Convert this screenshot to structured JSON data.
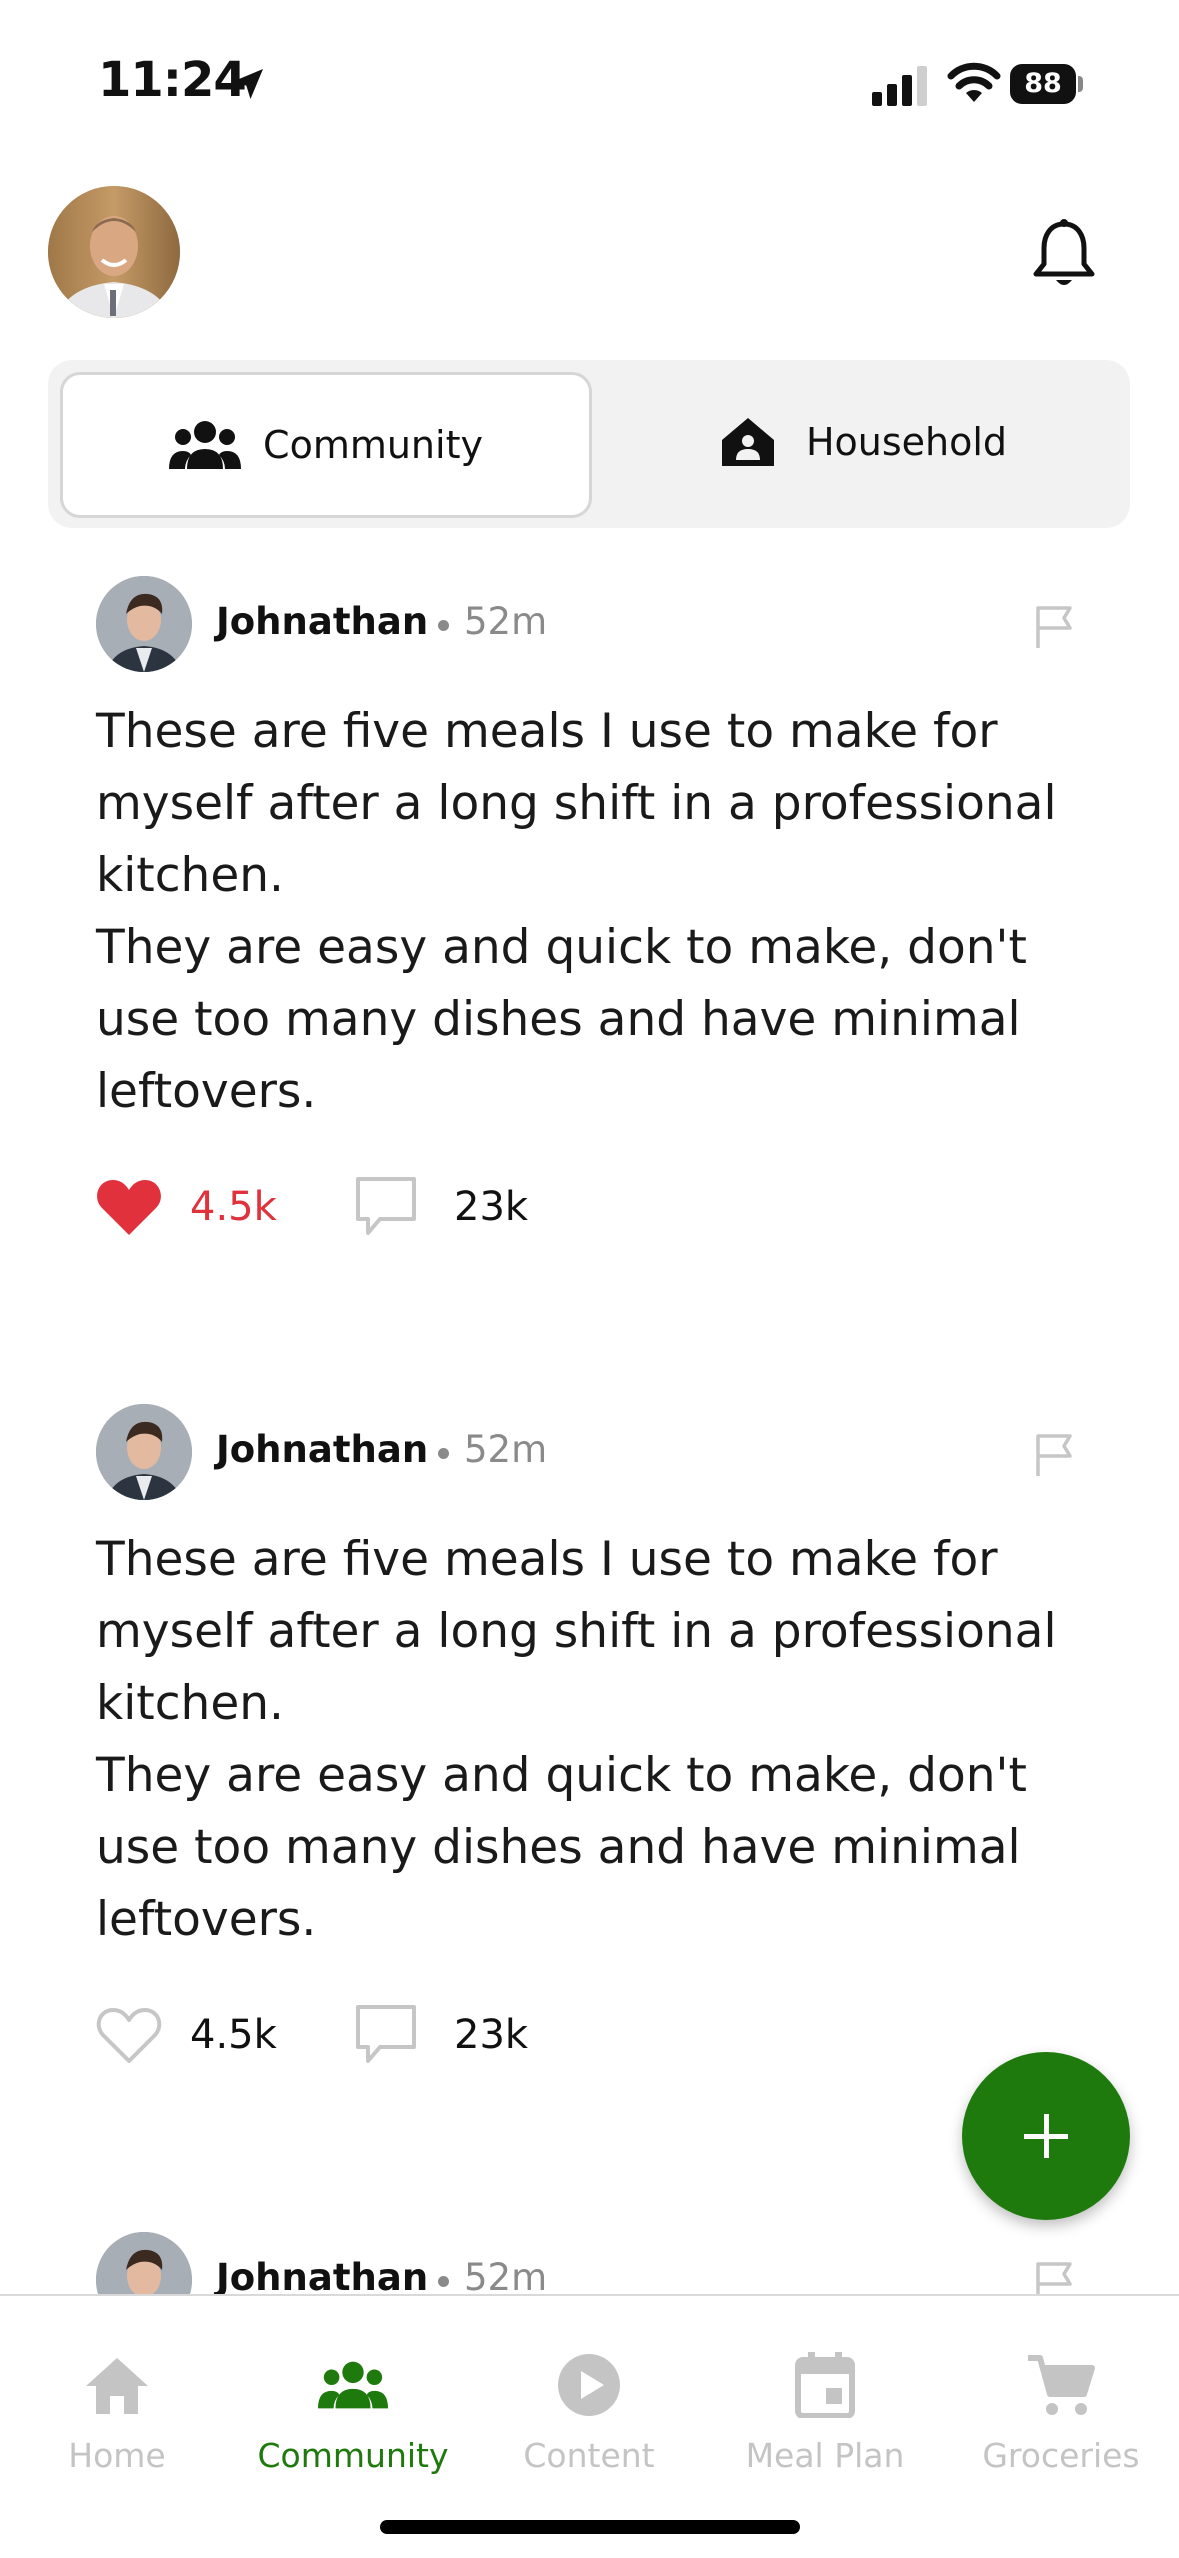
{
  "status_bar": {
    "time": "11:24",
    "battery": "88"
  },
  "header": {
    "avatar_icon": "user-avatar",
    "notification_icon": "bell-icon"
  },
  "segments": [
    {
      "label": "Community",
      "icon": "people-icon",
      "active": true
    },
    {
      "label": "Household",
      "icon": "home-icon",
      "active": false
    }
  ],
  "posts": [
    {
      "author": "Johnathan",
      "time": "52m",
      "text": "These are five meals I use to make for myself after a long shift in a professional kitchen.\nThey are easy and quick to make, don't use too many dishes and have minimal leftovers.",
      "likes": "4.5k",
      "comments": "23k",
      "liked": true
    },
    {
      "author": "Johnathan",
      "time": "52m",
      "text": "These are five meals I use to make for myself after a long shift in a professional kitchen.\nThey are easy and quick to make, don't use too many dishes and have minimal leftovers.",
      "likes": "4.5k",
      "comments": "23k",
      "liked": false
    },
    {
      "author": "Johnathan",
      "time": "52m"
    }
  ],
  "colors": {
    "accent": "#1f7a0e",
    "like": "#e0313d",
    "inactive": "#c4c4c4"
  },
  "bottom_nav": [
    {
      "label": "Home",
      "icon": "home-icon",
      "active": false
    },
    {
      "label": "Community",
      "icon": "people-icon",
      "active": true
    },
    {
      "label": "Content",
      "icon": "play-icon",
      "active": false
    },
    {
      "label": "Meal Plan",
      "icon": "calendar-icon",
      "active": false
    },
    {
      "label": "Groceries",
      "icon": "cart-icon",
      "active": false
    }
  ]
}
